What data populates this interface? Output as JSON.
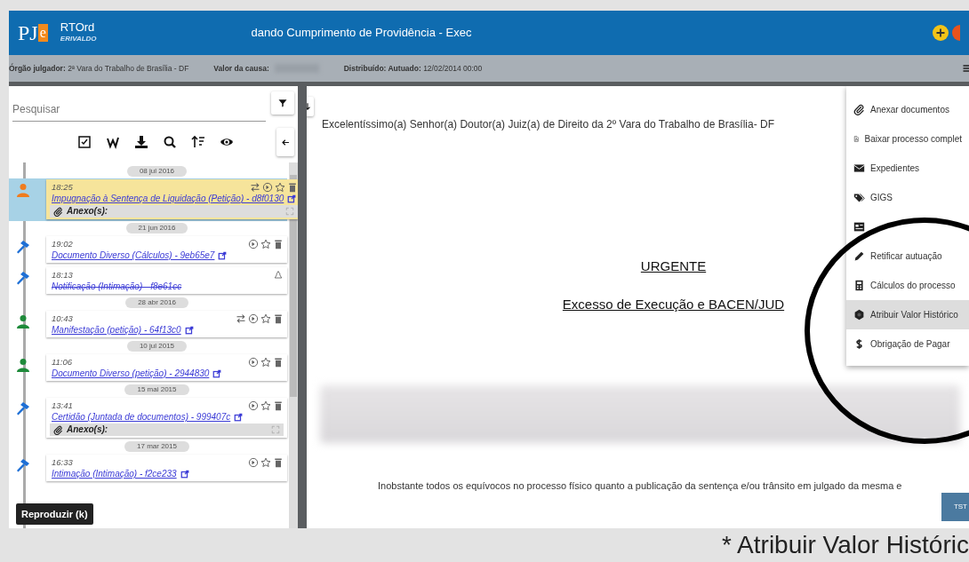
{
  "header": {
    "logo_left": "PJ",
    "logo_right": "e",
    "class_name": "RTOrd",
    "user": "ERIVALDO",
    "title": "dando Cumprimento de Providência - Exec"
  },
  "info_bar": [
    {
      "label": "Órgão julgador:",
      "value": "2ª Vara do Trabalho de Brasília - DF"
    },
    {
      "label": "Valor da causa:",
      "blurred": true
    },
    {
      "label": "Distribuído: Autuado:",
      "value": "12/02/2014 00:00"
    }
  ],
  "sidebar": {
    "search": {
      "placeholder": "Pesquisar"
    },
    "timeline": [
      {
        "date": "08 jul 2016",
        "items": [
          {
            "time": "18:25",
            "title": "Impugnação à Sentença de Liquidação (Petição) - d8f0130",
            "kind": "person",
            "color": "#f07c1e",
            "selected": true,
            "deleted": false,
            "movable": true,
            "attachment": "Anexo(s):"
          }
        ]
      },
      {
        "date": "21 jun 2016",
        "items": [
          {
            "time": "19:02",
            "title": "Documento Diverso (Cálculos) - 9eb65e7",
            "kind": "gavel",
            "color": "#1d6fd6",
            "selected": false,
            "deleted": false,
            "movable": false
          },
          {
            "time": "18:13",
            "title": "Notificação (Intimação) - f8e61cc",
            "kind": "gavel",
            "color": "#1d6fd6",
            "selected": false,
            "deleted": true
          }
        ]
      },
      {
        "date": "28 abr 2016",
        "items": [
          {
            "time": "10:43",
            "title": "Manifestação (petição) - 64f13c0",
            "kind": "person",
            "color": "#1e8a3a",
            "selected": false,
            "deleted": false,
            "movable": true
          }
        ]
      },
      {
        "date": "10 jul 2015",
        "items": [
          {
            "time": "11:06",
            "title": "Documento Diverso (petição) - 2944830",
            "kind": "person",
            "color": "#1e8a3a",
            "selected": false,
            "deleted": false,
            "movable": false
          }
        ]
      },
      {
        "date": "15 mai 2015",
        "items": [
          {
            "time": "13:41",
            "title": "Certidão (Juntada de documentos) - 999407c",
            "kind": "gavel",
            "color": "#1d6fd6",
            "selected": false,
            "deleted": false,
            "movable": false,
            "attachment": "Anexo(s):"
          }
        ]
      },
      {
        "date": "17 mar 2015",
        "items": [
          {
            "time": "16:33",
            "title": "Intimação (Intimação) - f2ce233",
            "kind": "gavel",
            "color": "#1d6fd6",
            "selected": false,
            "deleted": false,
            "movable": false
          }
        ]
      }
    ]
  },
  "tooltip": "Reproduzir (k)",
  "document": {
    "salutation": "Excelentíssimo(a) Senhor(a) Doutor(a) Juiz(a) de Direito da 2º Vara do Trabalho de Brasília- DF",
    "heading": "URGENTE",
    "subheading": "Excesso de Execução e BACEN/JUD",
    "body_line": "Inobstante todos os equívocos no processo físico quanto a publicação da sentença e/ou trânsito em julgado da mesma e"
  },
  "menu": [
    {
      "label": "Anexar documentos",
      "selected": false
    },
    {
      "label": "Baixar processo complet",
      "selected": false
    },
    {
      "label": "Expedientes",
      "selected": false
    },
    {
      "label": "GIGS",
      "selected": false
    },
    {
      "selected": false
    },
    {
      "label": "Retificar autuação",
      "selected": false
    },
    {
      "label": "Cálculos do processo",
      "selected": false
    },
    {
      "label": "Atribuir Valor Histórico",
      "selected": true
    },
    {
      "label": "Obrigação de Pagar",
      "selected": false
    }
  ],
  "corner_badge": "TST",
  "caption": "* Atribuir Valor Históric"
}
